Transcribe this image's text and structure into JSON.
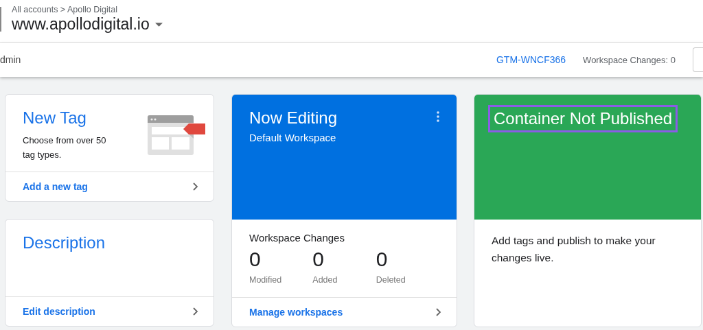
{
  "header": {
    "breadcrumb": "All accounts > Apollo Digital",
    "container_name": "www.apollodigital.io"
  },
  "nav": {
    "tab_fragment": "dmin",
    "container_id": "GTM-WNCF366",
    "workspace_changes": "Workspace Changes: 0"
  },
  "new_tag_card": {
    "title": "New Tag",
    "description": "Choose from over 50 tag types.",
    "link": "Add a new tag"
  },
  "description_card": {
    "title": "Description",
    "link": "Edit description"
  },
  "now_editing_card": {
    "title": "Now Editing",
    "workspace": "Default Workspace",
    "changes_title": "Workspace Changes",
    "stats": [
      {
        "value": "0",
        "label": "Modified"
      },
      {
        "value": "0",
        "label": "Added"
      },
      {
        "value": "0",
        "label": "Deleted"
      }
    ],
    "link": "Manage workspaces"
  },
  "publish_card": {
    "title": "Container Not Published",
    "highlighted": true,
    "message": "Add tags and publish to make your changes live."
  }
}
